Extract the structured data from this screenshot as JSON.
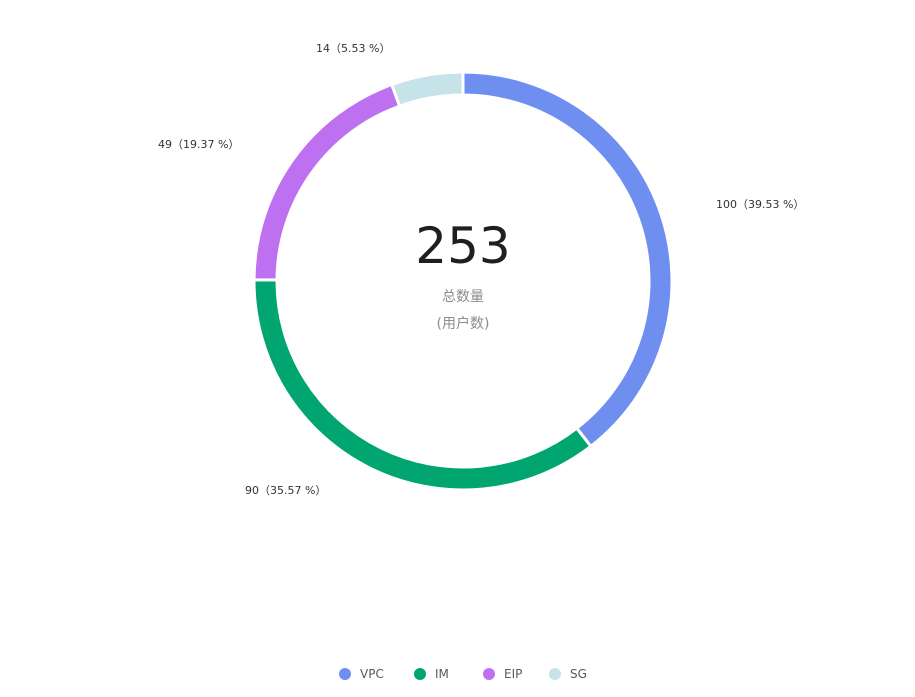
{
  "chart_data": {
    "type": "pie",
    "variant": "donut",
    "total": 253,
    "center_caption": "总数量",
    "center_unit": "(用户数)",
    "legend_position": "bottom",
    "series": [
      {
        "name": "VPC",
        "value": 100,
        "percent": 39.53,
        "color": "#6e8ff0",
        "label": "100（39.53 %）"
      },
      {
        "name": "IM",
        "value": 90,
        "percent": 35.57,
        "color": "#00a56f",
        "label": "90（35.57 %）"
      },
      {
        "name": "EIP",
        "value": 49,
        "percent": 19.37,
        "color": "#bd70ef",
        "label": "49（19.37 %）"
      },
      {
        "name": "SG",
        "value": 14,
        "percent": 5.53,
        "color": "#c6e3ea",
        "label": "14（5.53 %）"
      }
    ]
  }
}
